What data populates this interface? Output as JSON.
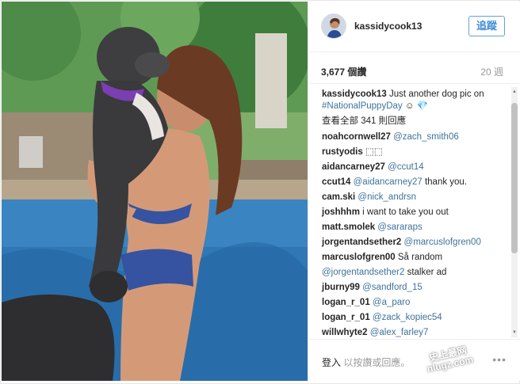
{
  "header": {
    "username": "kassidycook13",
    "follow_label": "追蹤"
  },
  "stats": {
    "likes": "3,677 個讚",
    "age": "20 週"
  },
  "caption": {
    "user": "kassidycook13",
    "text": " Just another dog pic on ",
    "hashtag": "#NationalPuppyDay",
    "emoji": " ☺ 💎"
  },
  "view_all_label": "查看全部 341 則回應",
  "comments": [
    {
      "user": "noahcornwell27",
      "mention": " @zach_smith06",
      "text": ""
    },
    {
      "user": "rustyodis",
      "mention": "",
      "text": " ⬚⬚"
    },
    {
      "user": "aidancarney27",
      "mention": " @ccut14",
      "text": ""
    },
    {
      "user": "ccut14",
      "mention": " @aidancarney27",
      "text": " thank you."
    },
    {
      "user": "cam.ski",
      "mention": " @nick_andrsn",
      "text": ""
    },
    {
      "user": "joshhhm",
      "mention": "",
      "text": " i want to take you out"
    },
    {
      "user": "matt.smolek",
      "mention": " @sararaps",
      "text": ""
    },
    {
      "user": "jorgentandsether2",
      "mention": " @marcuslofgren00",
      "text": ""
    },
    {
      "user": "marcuslofgren00",
      "mention": "",
      "text": " Så random"
    },
    {
      "user": "",
      "mention": "@jorgentandsether2",
      "text": " stalker ad"
    },
    {
      "user": "jburny99",
      "mention": " @sandford_15",
      "text": ""
    },
    {
      "user": "logan_r_01",
      "mention": " @a_paro",
      "text": ""
    },
    {
      "user": "logan_r_01",
      "mention": " @zack_kopiec54",
      "text": ""
    },
    {
      "user": "willwhyte2",
      "mention": " @alex_farley7",
      "text": ""
    }
  ],
  "footer": {
    "login_link": "登入",
    "login_rest": " 以按讚或回應。",
    "more": "•••"
  },
  "watermark": {
    "line1": "史上最网",
    "line2": "nlugz.com"
  },
  "colors": {
    "link": "#3f729b",
    "follow": "#3f8ad6",
    "muted": "#999999"
  }
}
